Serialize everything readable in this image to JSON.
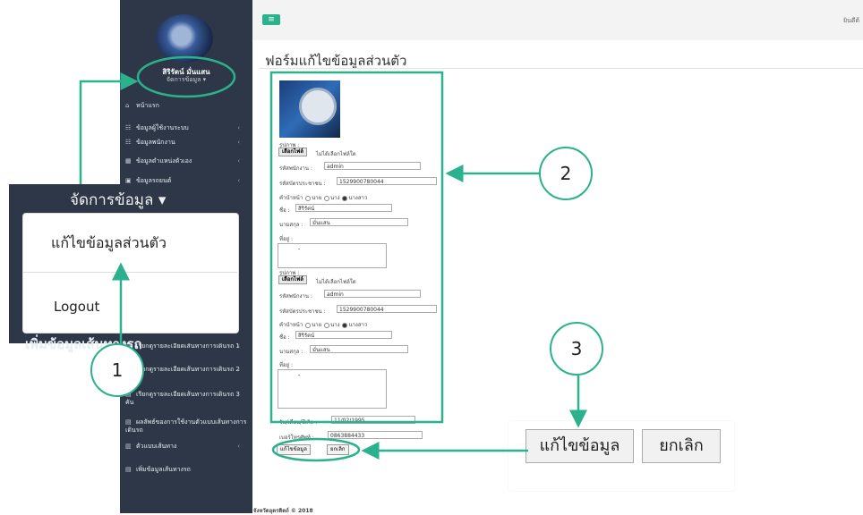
{
  "sidebar": {
    "user_name": "สิริรัตน์ มั่นแสน",
    "manage_label": "จัดการข้อมูล ▾",
    "items": [
      {
        "icon": "home-icon",
        "label": "หน้าแรก",
        "chev": false
      },
      {
        "icon": "users-icon",
        "label": "ข้อมูลผู้ใช้งานระบบ",
        "chev": true
      },
      {
        "icon": "users-icon",
        "label": "ข้อมูลพนักงาน",
        "chev": true
      },
      {
        "icon": "building-icon",
        "label": "ข้อมูลตำแหน่งตัวเอง",
        "chev": true
      },
      {
        "icon": "car-icon",
        "label": "ข้อมูลรถยนต์",
        "chev": true
      },
      {
        "icon": "doc-icon",
        "label": "เรียกดูรายละเอียดเส้นทางการเดินรถ 1 คัน",
        "chev": true
      },
      {
        "icon": "doc-icon",
        "label": "เรียกดูรายละเอียดเส้นทางการเดินรถ 2 คัน",
        "chev": true
      },
      {
        "icon": "doc-icon",
        "label": "เรียกดูรายละเอียดเส้นทางการเดินรถ 3 คัน",
        "chev": true
      },
      {
        "icon": "doc-icon",
        "label": "ผลลัพธ์ของการใช้งานตัวแบบเส้นทางการเดินรถ",
        "chev": true
      },
      {
        "icon": "chart-icon",
        "label": "ตัวแบบเส้นทาง",
        "chev": true
      },
      {
        "icon": "doc-icon",
        "label": "เพิ่มข้อมูลเส้นทางรถ",
        "chev": false
      }
    ]
  },
  "topbar": {
    "menu_icon": "≡",
    "right_text": "ยินดีต้"
  },
  "form": {
    "title": "ฟอร์มแก้ไขข้อมูลส่วนตัว",
    "photo_label": "รูปภาพ :",
    "file_button": "เลือกไฟล์",
    "file_status": "ไม่ได้เลือกไฟล์ใด",
    "emp_id_label": "รหัสพนักงาน :",
    "emp_id_value": "admin",
    "citizen_label": "รหัสบัตรประชาชน :",
    "citizen_value": "1529900780044",
    "prefix_label": "คำนำหน้า",
    "prefix_options": [
      "นาย",
      "นาง",
      "นางสาว"
    ],
    "prefix_selected": "นางสาว",
    "firstname_label": "ชื่อ :",
    "firstname_value": "สิริรัตน์",
    "lastname_label": "นามสกุล :",
    "lastname_value": "มั่นแสน",
    "address_label": "ที่อยู่ :",
    "address_value": "-",
    "birthdate_label": "วัน/เดือน/ปีเกิด :",
    "birthdate_value": "11/02/1995",
    "phone_label": "เบอร์โทรศัพท์ :",
    "phone_value": "0863884433",
    "save_button": "แก้ไขข้อมูล",
    "cancel_button": "ยกเลิก"
  },
  "footer": "จังหวัดอุตรดิตถ์ © 2018",
  "callouts": {
    "dropdown_title": "จัดการข้อมูล ▾",
    "dropdown_edit": "แก้ไขข้อมูลส่วนตัว",
    "dropdown_logout": "Logout",
    "below_dropdown": "เพิ่มข้อมูลเส้นทางรถ",
    "big_save": "แก้ไขข้อมูล",
    "big_cancel": "ยกเลิก",
    "num1": "1",
    "num2": "2",
    "num3": "3"
  },
  "colors": {
    "accent": "#2bb28c",
    "sidebar": "#2d3748"
  }
}
